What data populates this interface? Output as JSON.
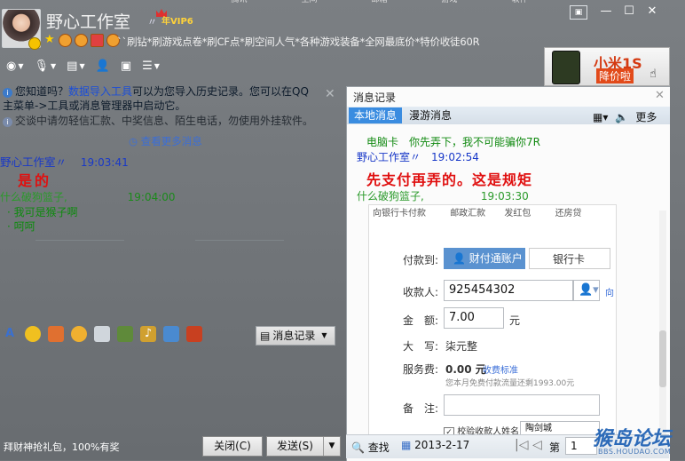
{
  "header": {
    "title": "野心工作室",
    "title_mark": "〃",
    "vip_label": "年VIP6",
    "signature": "``刷钻*刷游戏点卷*刷CF点*刷空间人气*各种游戏装备*全网最底价*特价收徒60R",
    "top_strip": [
      "腾讯",
      "空间",
      "邮箱",
      "游戏",
      "软件"
    ]
  },
  "window_controls": {
    "skin": "▣",
    "minimize": "—",
    "maximize": "☐",
    "close": "✕"
  },
  "ad": {
    "line1": "小米1S",
    "line2": "降价啦"
  },
  "chat": {
    "tip": {
      "prefix": "您知道吗？",
      "link": "数据导入工具",
      "rest": "可以为您导入历史记录。您可以在QQ",
      "line2": "主菜单->工具或消息管理器中启动它。"
    },
    "safety": "交谈中请勿轻信汇款、中奖信息、陌生电话，勿使用外挂软件。",
    "more_link": "查看更多消息",
    "messages": [
      {
        "sender": "野心工作室〃",
        "time": "19:03:41",
        "text": "是的"
      },
      {
        "sender": "什么破狗篮子,",
        "time": "19:04:00",
        "lines": [
          "我可是猴子啊",
          "呵呵"
        ]
      }
    ]
  },
  "input_toolbar": {
    "history_label": "消息记录"
  },
  "bottom": {
    "promo": "拜财神抢礼包，100%有奖",
    "close_label": "关闭(C)",
    "send_label": "发送(S)"
  },
  "history": {
    "title": "消息记录",
    "tabs": [
      "本地消息",
      "漫游消息"
    ],
    "more": "更多",
    "lines": [
      {
        "label": "电脑卡",
        "text": "你先弄下，我不可能骗你7R"
      },
      {
        "sender": "野心工作室〃",
        "time": "19:02:54"
      },
      {
        "text": "先支付再弄的。这是规矩"
      },
      {
        "sender": "什么破狗篮子,",
        "time": "19:03:30"
      }
    ],
    "shot": {
      "toplinks": [
        "向银行卡付款",
        "邮政汇款",
        "发红包",
        "还房贷"
      ],
      "pay_to": "付款到:",
      "tab_account": "财付通账户",
      "tab_card": "银行卡",
      "payee_label": "收款人:",
      "payee_value": "925454302",
      "amount_label": "金　额:",
      "amount_value": "7.00",
      "unit": "元",
      "upper_label": "大　写:",
      "upper_value": "柒元整",
      "fee_label": "服务费:",
      "fee_value": "0.00 元",
      "fee_link": "收费标准",
      "fee_note": "您本月免费付款流量还剩1993.00元",
      "note_label": "备　注:",
      "check_label": "校验收款人姓名",
      "check_value": "陶剑城",
      "side_link": "向"
    },
    "bottom": {
      "search": "查找",
      "date": "2013-2-17",
      "page_label": "第",
      "page_value": "1"
    }
  },
  "watermark": {
    "line1": "猴岛论坛",
    "line2": "BBS.HOUDAO.COM"
  }
}
